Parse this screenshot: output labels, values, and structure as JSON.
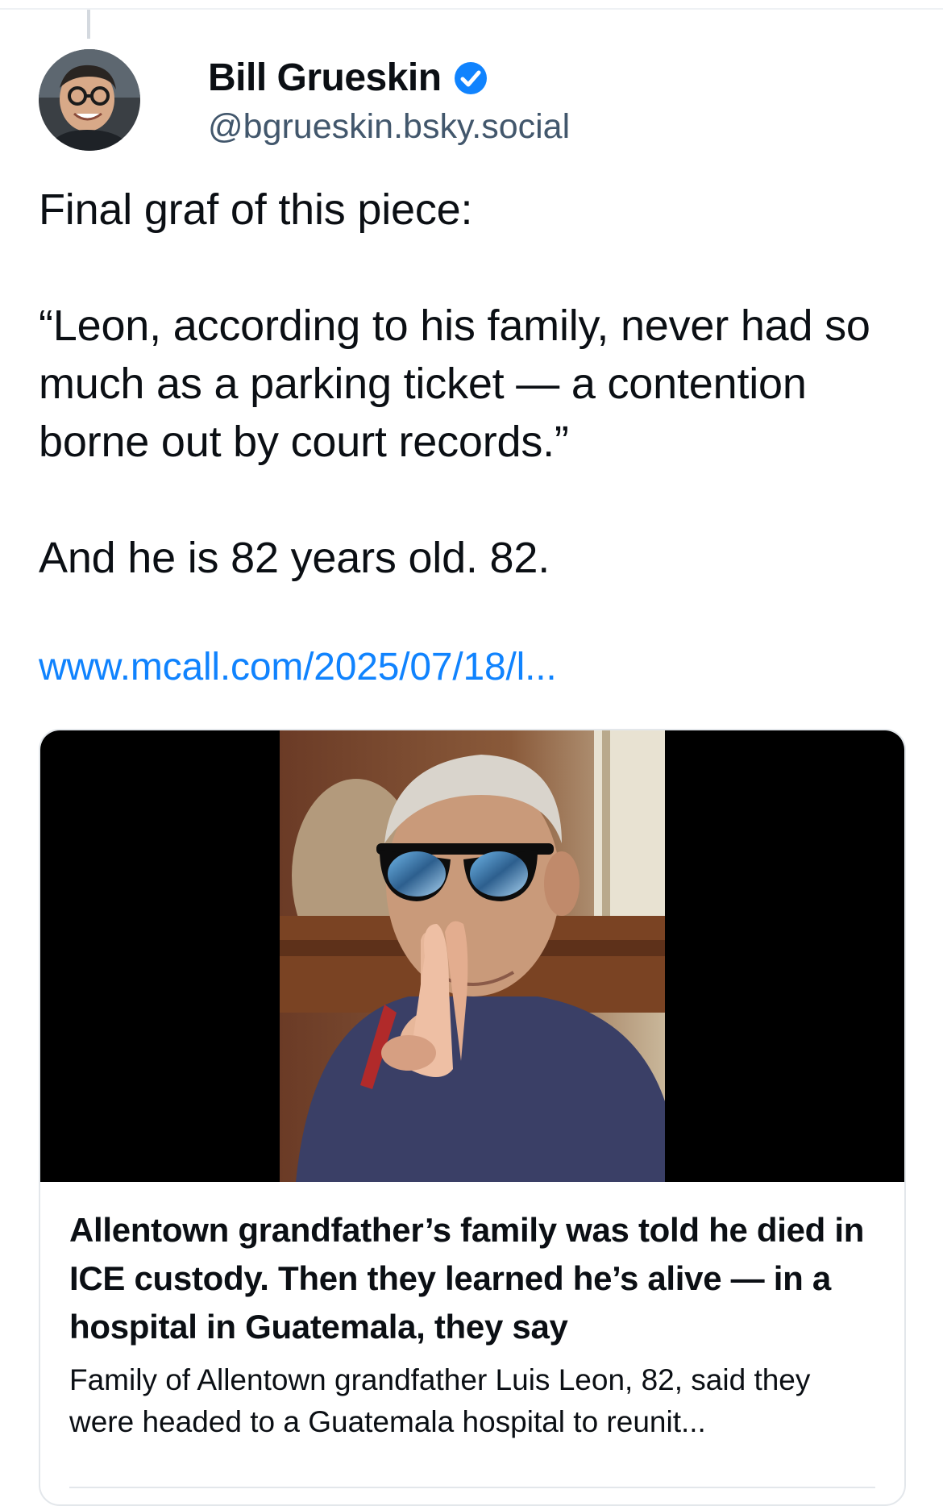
{
  "author": {
    "display_name": "Bill Grueskin",
    "handle": "@bgrueskin.bsky.social",
    "avatar_icon": "user-avatar",
    "verified_icon": "verified-check-icon",
    "verified_color": "#1083fe"
  },
  "post": {
    "paragraphs": [
      "Final graf of this piece:",
      "“Leon, according to his family, never had so much as a parking ticket — a contention borne out by court records.”",
      "And he is 82 years old. 82."
    ],
    "link_text": "www.mcall.com/2025/07/18/l..."
  },
  "embed": {
    "image_alt": "photo",
    "title": "Allentown grandfather’s family was told he died in ICE custody. Then they learned he’s alive — in a hospital in Guatemala, they say",
    "description": "Family of Allentown grandfather Luis Leon, 82, said they were headed to a Guatemala hospital to reunit..."
  },
  "colors": {
    "link": "#1083fe",
    "handle": "#42576c",
    "text": "#0b0f14",
    "border": "#e3e7eb"
  }
}
